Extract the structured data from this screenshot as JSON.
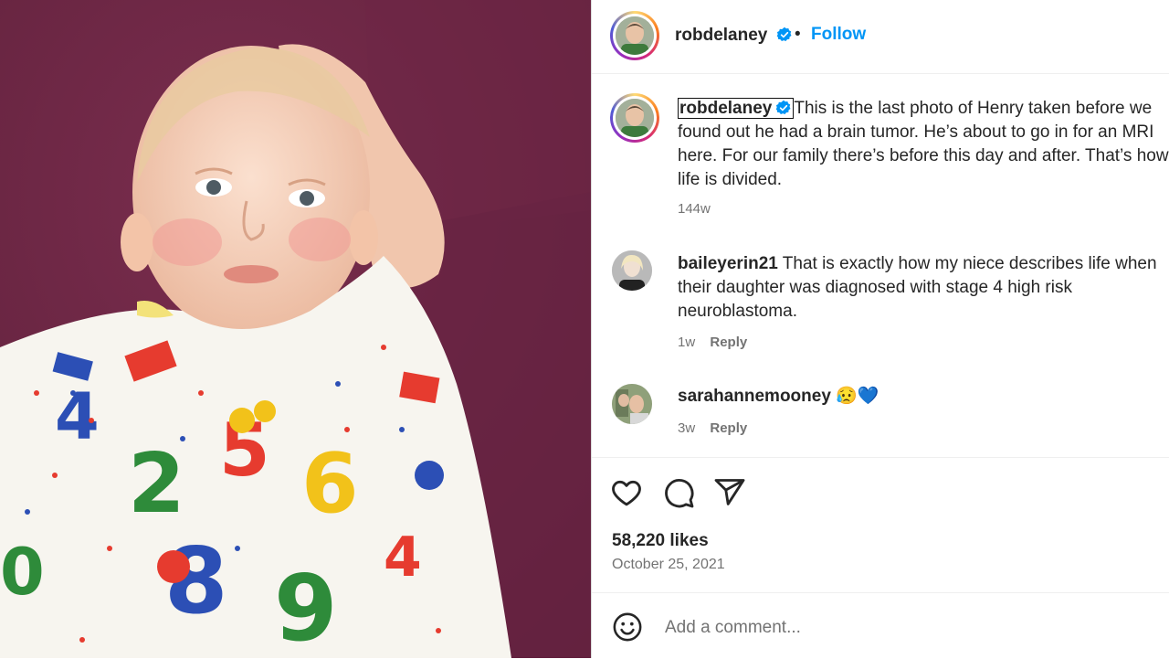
{
  "post": {
    "username": "robdelaney",
    "follow_label": "Follow",
    "separator": "•",
    "caption": "This is the last photo of Henry taken before we found out he had a brain tumor. He’s about to go in for an MRI here. For our family there’s before this day and after. That’s how life is divided.",
    "caption_time": "144w",
    "likes": "58,220 likes",
    "date": "October 25, 2021"
  },
  "comments": [
    {
      "username": "baileyerin21",
      "text": "That is exactly how my niece describes life when their daughter was diagnosed with stage 4 high risk neuroblastoma.",
      "time": "1w",
      "reply_label": "Reply"
    },
    {
      "username": "sarahannemooney",
      "text": "😥💙",
      "time": "3w",
      "reply_label": "Reply"
    }
  ],
  "add_comment": {
    "placeholder": "Add a comment..."
  },
  "icons": {
    "like": "heart-icon",
    "comment": "comment-icon",
    "share": "share-icon",
    "emoji": "smile-icon",
    "verified": "verified-badge-icon"
  },
  "colors": {
    "follow": "#0095f6",
    "verified": "#0095f6",
    "muted": "#737373",
    "text": "#262626"
  }
}
